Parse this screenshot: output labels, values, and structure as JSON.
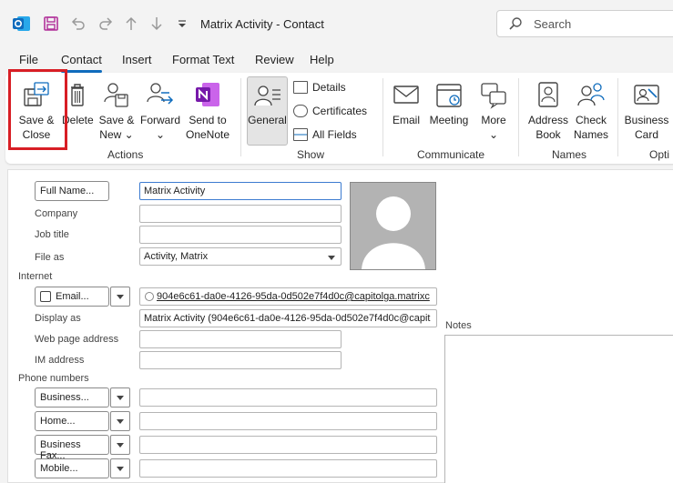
{
  "window": {
    "title": "Matrix Activity  -  Contact"
  },
  "search": {
    "placeholder": "Search"
  },
  "menu": [
    "File",
    "Contact",
    "Insert",
    "Format Text",
    "Review",
    "Help"
  ],
  "ribbon": {
    "save_close": {
      "line1": "Save &",
      "line2": "Close"
    },
    "delete": "Delete",
    "save_new": {
      "line1": "Save &",
      "line2": "New ⌄"
    },
    "forward": {
      "line1": "Forward",
      "line2": "⌄"
    },
    "send_onenote": {
      "line1": "Send to",
      "line2": "OneNote"
    },
    "general": "General",
    "details": "Details",
    "certificates": "Certificates",
    "all_fields": "All Fields",
    "email": "Email",
    "meeting": "Meeting",
    "more": {
      "line1": "More",
      "line2": "⌄"
    },
    "address_book": {
      "line1": "Address",
      "line2": "Book"
    },
    "check_names": {
      "line1": "Check",
      "line2": "Names"
    },
    "business_card": {
      "line1": "Business",
      "line2": "Card"
    },
    "groups": {
      "actions": "Actions",
      "show": "Show",
      "communicate": "Communicate",
      "names": "Names",
      "options": "Opti"
    }
  },
  "form": {
    "full_name_button": "Full Name...",
    "full_name_value": "Matrix Activity",
    "company_label": "Company",
    "company_value": "",
    "job_title_label": "Job title",
    "job_title_value": "",
    "file_as_label": "File as",
    "file_as_value": "Activity, Matrix",
    "internet_label": "Internet",
    "email_button": "Email...",
    "email_value": "904e6c61-da0e-4126-95da-0d502e7f4d0c@capitolga.matrixc",
    "display_as_label": "Display as",
    "display_as_value": "Matrix Activity (904e6c61-da0e-4126-95da-0d502e7f4d0c@capit",
    "web_label": "Web page address",
    "web_value": "",
    "im_label": "IM address",
    "im_value": "",
    "notes_label": "Notes",
    "phone_label": "Phone numbers",
    "phones": [
      {
        "type": "Business...",
        "value": ""
      },
      {
        "type": "Home...",
        "value": ""
      },
      {
        "type": "Business Fax...",
        "value": ""
      },
      {
        "type": "Mobile...",
        "value": ""
      }
    ]
  },
  "colors": {
    "accent": "#0f6cbd",
    "highlight": "#d81e25",
    "onenote": "#7719aa"
  }
}
